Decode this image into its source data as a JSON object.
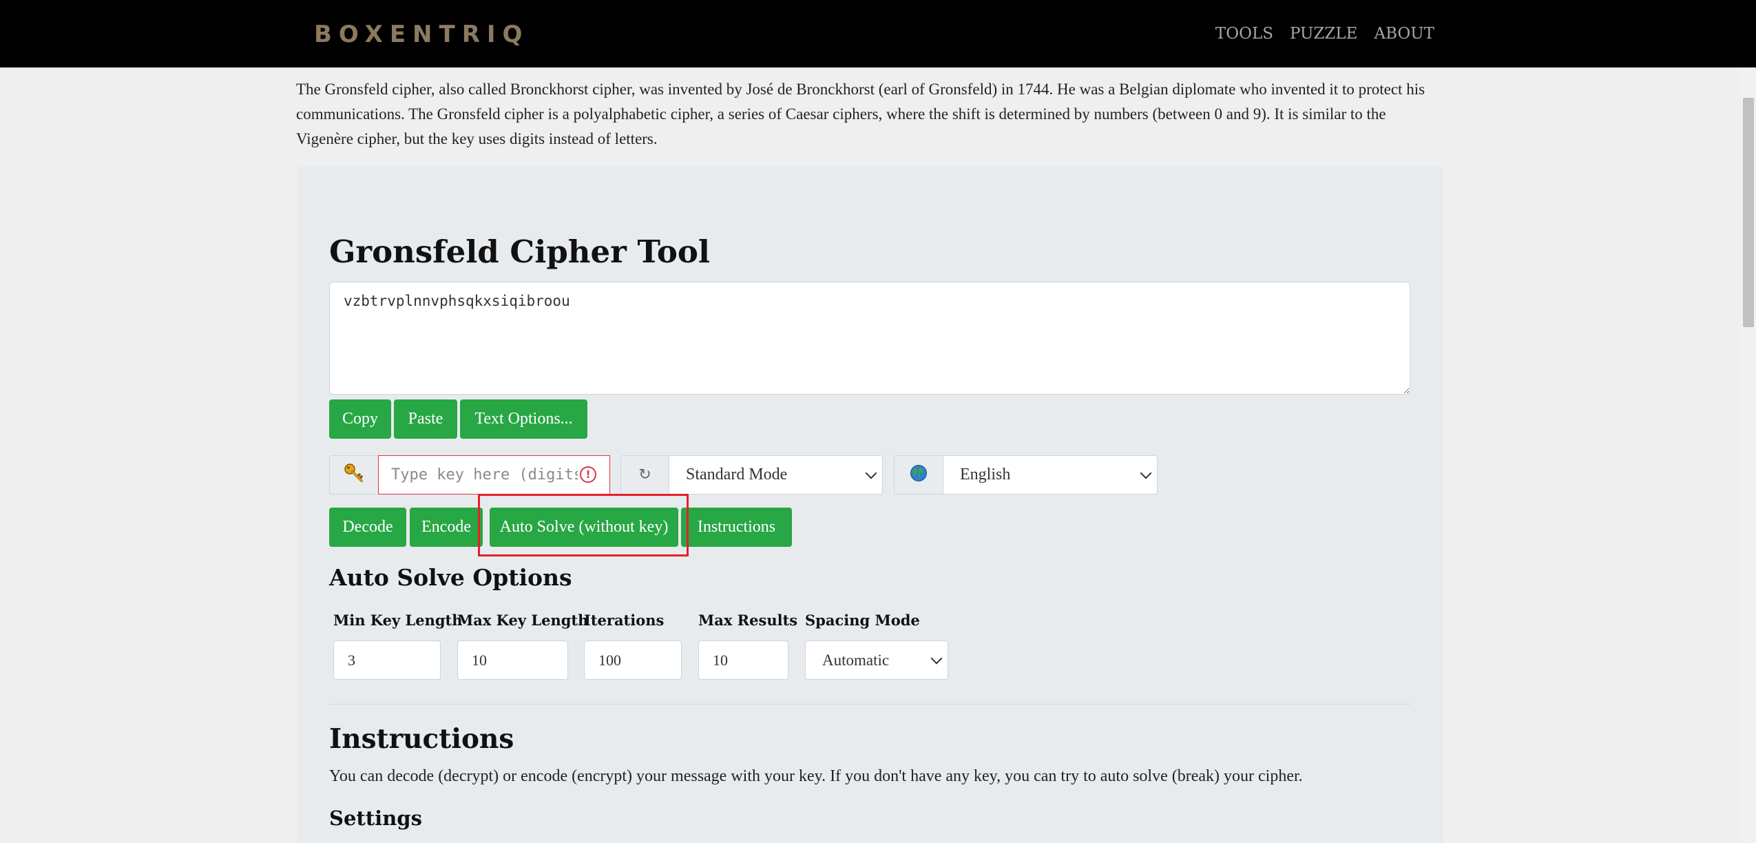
{
  "nav": {
    "logo": "BOXENTRIQ",
    "links": [
      "TOOLS",
      "PUZZLE",
      "ABOUT"
    ]
  },
  "intro": "The Gronsfeld cipher, also called Bronckhorst cipher, was invented by José de Bronckhorst (earl of Gronsfeld) in 1744. He was a Belgian diplomate who invented it to protect his communications. The Gronsfeld cipher is a polyalphabetic cipher, a series of Caesar ciphers, where the shift is determined by numbers (between 0 and 9). It is similar to the Vigenère cipher, but the key uses digits instead of letters.",
  "tool": {
    "title": "Gronsfeld Cipher Tool",
    "cipher_text": "vzbtrvplnnvphsqkxsiqibroou",
    "text_buttons": {
      "copy": "Copy",
      "paste": "Paste",
      "text_options": "Text Options..."
    },
    "key_placeholder": "Type key here (digits)",
    "key_alert": "!",
    "mode_icon": "↻",
    "mode": "Standard Mode",
    "language": "English",
    "actions": {
      "decode": "Decode",
      "encode": "Encode",
      "auto_solve": "Auto Solve (without key)",
      "instructions": "Instructions"
    }
  },
  "auto_solve": {
    "heading": "Auto Solve Options",
    "min_key_label": "Min Key Length",
    "min_key": "3",
    "max_key_label": "Max Key Length",
    "max_key": "10",
    "iterations_label": "Iterations",
    "iterations": "100",
    "max_results_label": "Max Results",
    "max_results": "10",
    "spacing_label": "Spacing Mode",
    "spacing": "Automatic"
  },
  "instructions": {
    "heading": "Instructions",
    "text": "You can decode (decrypt) or encode (encrypt) your message with your key. If you don't have any key, you can try to auto solve (break) your cipher.",
    "settings_heading": "Settings"
  },
  "icons": {
    "key": "key-icon",
    "refresh": "refresh-icon",
    "globe": "globe-icon",
    "alert": "alert-icon"
  },
  "colors": {
    "nav_bg": "#000000",
    "logo": "#8c7a5e",
    "button_green": "#28a745",
    "panel_bg": "#e8ebee",
    "highlight": "#e5202a",
    "alert": "#dc3545"
  }
}
